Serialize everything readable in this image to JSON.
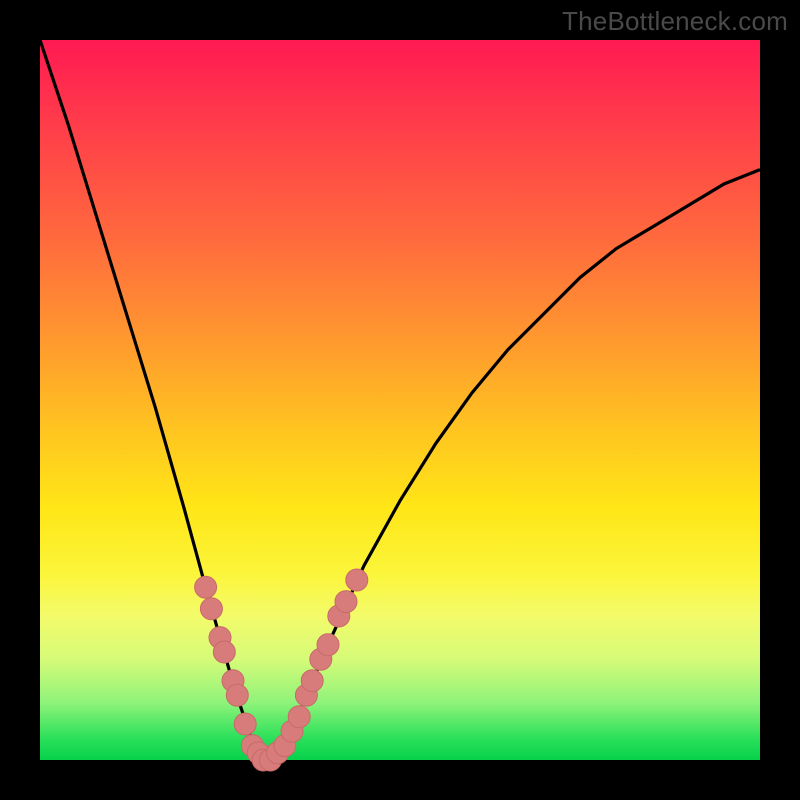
{
  "watermark": "TheBottleneck.com",
  "colors": {
    "curve_stroke": "#000000",
    "marker_fill": "#d77b7b",
    "marker_stroke": "#c96a6a"
  },
  "chart_data": {
    "type": "line",
    "title": "",
    "xlabel": "",
    "ylabel": "",
    "xlim": [
      0,
      100
    ],
    "ylim": [
      0,
      100
    ],
    "curve": {
      "note": "V-shaped bottleneck curve; y is bottleneck percentage (0=green bottom, 100=red top). Minimum near x≈31.",
      "x": [
        0,
        4,
        8,
        12,
        16,
        20,
        23,
        25,
        27,
        29,
        30,
        31,
        32,
        33,
        35,
        37,
        40,
        45,
        50,
        55,
        60,
        65,
        70,
        75,
        80,
        85,
        90,
        95,
        100
      ],
      "y": [
        100,
        88,
        75,
        62,
        49,
        35,
        24,
        17,
        10,
        4,
        1,
        0,
        0,
        1,
        4,
        9,
        16,
        27,
        36,
        44,
        51,
        57,
        62,
        67,
        71,
        74,
        77,
        80,
        82
      ]
    },
    "markers": {
      "note": "Highlighted data points (pink dots) clustered around the valley of the curve.",
      "points": [
        {
          "x": 23.0,
          "y": 24
        },
        {
          "x": 23.8,
          "y": 21
        },
        {
          "x": 25.0,
          "y": 17
        },
        {
          "x": 25.6,
          "y": 15
        },
        {
          "x": 26.8,
          "y": 11
        },
        {
          "x": 27.4,
          "y": 9
        },
        {
          "x": 28.5,
          "y": 5
        },
        {
          "x": 29.5,
          "y": 2
        },
        {
          "x": 30.3,
          "y": 1
        },
        {
          "x": 31.0,
          "y": 0
        },
        {
          "x": 32.0,
          "y": 0
        },
        {
          "x": 33.0,
          "y": 1
        },
        {
          "x": 34.0,
          "y": 2
        },
        {
          "x": 35.0,
          "y": 4
        },
        {
          "x": 36.0,
          "y": 6
        },
        {
          "x": 37.0,
          "y": 9
        },
        {
          "x": 37.8,
          "y": 11
        },
        {
          "x": 39.0,
          "y": 14
        },
        {
          "x": 40.0,
          "y": 16
        },
        {
          "x": 41.5,
          "y": 20
        },
        {
          "x": 42.5,
          "y": 22
        },
        {
          "x": 44.0,
          "y": 25
        }
      ]
    }
  }
}
